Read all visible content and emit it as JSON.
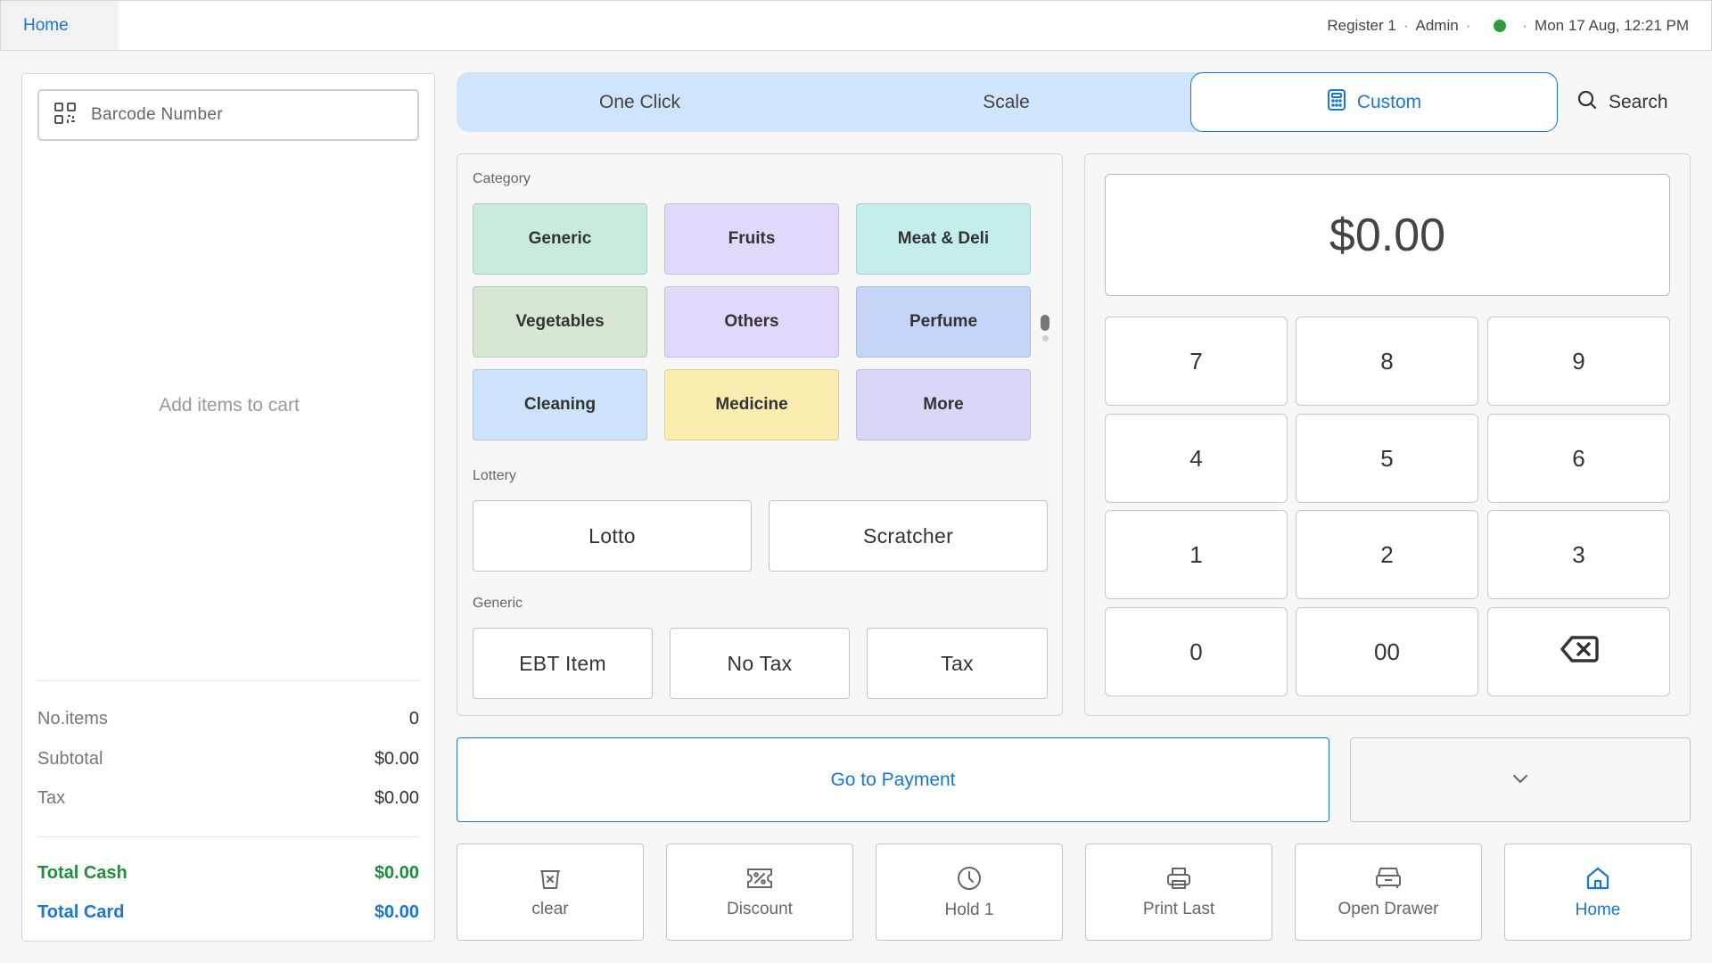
{
  "topbar": {
    "home_tab": "Home",
    "register": "Register 1",
    "user": "Admin",
    "sep": "·",
    "datetime": "Mon 17 Aug, 12:21 PM",
    "status_color": "#2e9b3d"
  },
  "cart": {
    "barcode_placeholder": "Barcode Number",
    "empty_message": "Add items to cart",
    "summary": {
      "items_label": "No.items",
      "items_value": "0",
      "subtotal_label": "Subtotal",
      "subtotal_value": "$0.00",
      "tax_label": "Tax",
      "tax_value": "$0.00",
      "cash_label": "Total Cash",
      "cash_value": "$0.00",
      "card_label": "Total Card",
      "card_value": "$0.00"
    }
  },
  "modes": {
    "tabs": [
      "One Click",
      "Scale",
      "Custom"
    ],
    "active": "Custom",
    "search_label": "Search"
  },
  "categories": {
    "label": "Category",
    "items": [
      {
        "name": "Generic",
        "color": "#c8ecd9"
      },
      {
        "name": "Fruits",
        "color": "#e2d9fa"
      },
      {
        "name": "Meat & Deli",
        "color": "#c3eeea"
      },
      {
        "name": "Vegetables",
        "color": "#d8e6d4"
      },
      {
        "name": "Others",
        "color": "#e2d9fa"
      },
      {
        "name": "Perfume",
        "color": "#c5d5f7"
      },
      {
        "name": "Cleaning",
        "color": "#cde3f9"
      },
      {
        "name": "Medicine",
        "color": "#fbedb0"
      },
      {
        "name": "More",
        "color": "#d9d7f7"
      }
    ]
  },
  "lottery": {
    "label": "Lottery",
    "buttons": [
      "Lotto",
      "Scratcher"
    ]
  },
  "generic": {
    "label": "Generic",
    "buttons": [
      "EBT Item",
      "No Tax",
      "Tax"
    ]
  },
  "keypad": {
    "display": "$0.00",
    "keys": [
      "7",
      "8",
      "9",
      "4",
      "5",
      "6",
      "1",
      "2",
      "3",
      "0",
      "00"
    ]
  },
  "payment": {
    "label": "Go to Payment"
  },
  "actions": [
    {
      "label": "clear",
      "icon": "trash-icon"
    },
    {
      "label": "Discount",
      "icon": "discount-icon"
    },
    {
      "label": "Hold 1",
      "icon": "clock-icon"
    },
    {
      "label": "Print Last",
      "icon": "printer-icon"
    },
    {
      "label": "Open Drawer",
      "icon": "drawer-icon"
    },
    {
      "label": "Home",
      "icon": "home-icon"
    }
  ],
  "colors": {
    "accent": "#1976d2",
    "cash": "#1e8e3e",
    "tab_bar": "#cfe5fb"
  }
}
